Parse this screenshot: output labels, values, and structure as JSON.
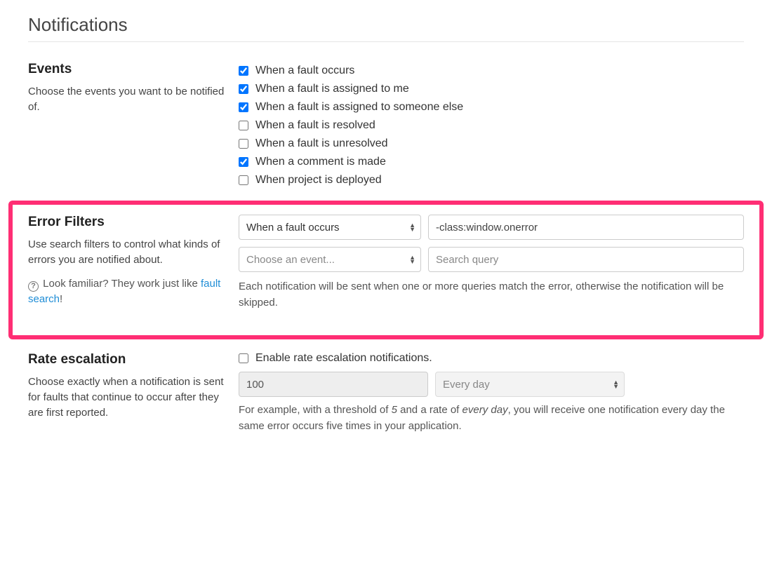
{
  "page_title": "Notifications",
  "events": {
    "title": "Events",
    "desc": "Choose the events you want to be notified of.",
    "items": [
      {
        "label": "When a fault occurs",
        "checked": true
      },
      {
        "label": "When a fault is assigned to me",
        "checked": true
      },
      {
        "label": "When a fault is assigned to someone else",
        "checked": true
      },
      {
        "label": "When a fault is resolved",
        "checked": false
      },
      {
        "label": "When a fault is unresolved",
        "checked": false
      },
      {
        "label": "When a comment is made",
        "checked": true
      },
      {
        "label": "When project is deployed",
        "checked": false
      }
    ]
  },
  "error_filters": {
    "title": "Error Filters",
    "desc": "Use search filters to control what kinds of errors you are notified about.",
    "hint_prefix": "Look familiar? They work just like ",
    "hint_link": "fault search",
    "hint_suffix": "!",
    "rows": [
      {
        "event_selected": "When a fault occurs",
        "query_value": "-class:window.onerror",
        "query_placeholder": ""
      },
      {
        "event_selected": "Choose an event...",
        "query_value": "",
        "query_placeholder": "Search query"
      }
    ],
    "note": "Each notification will be sent when one or more queries match the error, otherwise the notification will be skipped."
  },
  "rate_escalation": {
    "title": "Rate escalation",
    "desc": "Choose exactly when a notification is sent for faults that continue to occur after they are first reported.",
    "enable_label": "Enable rate escalation notifications.",
    "enable_checked": false,
    "threshold_value": "100",
    "period_value": "Every day",
    "example_pre": "For example, with a threshold of ",
    "example_threshold": "5",
    "example_mid": " and a rate of ",
    "example_rate": "every day",
    "example_post": ", you will receive one notification every day the same error occurs five times in your application."
  }
}
